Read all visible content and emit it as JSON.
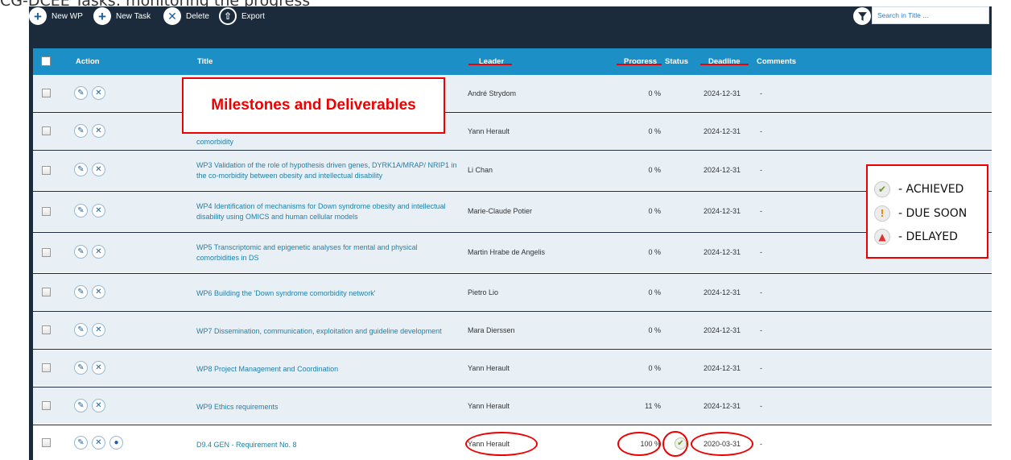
{
  "caption": "CG-DCEE Tasks: monitoring the progress",
  "toolbar": {
    "new_wp": "New WP",
    "new_task": "New Task",
    "delete": "Delete",
    "export": "Export",
    "search_placeholder": "Search in Title ..."
  },
  "columns": {
    "action": "Action",
    "title": "Title",
    "leader": "Leader",
    "progress": "Progress",
    "status": "Status",
    "deadline": "Deadline",
    "comments": "Comments"
  },
  "rows": [
    {
      "title": "",
      "leader": "André Strydom",
      "progress": "0 %",
      "deadline": "2024-12-31",
      "comment": "-"
    },
    {
      "title": "comorbidity",
      "leader": "Yann Herault",
      "progress": "0 %",
      "deadline": "2024-12-31",
      "comment": "-"
    },
    {
      "title": "WP3 Validation of the role of hypothesis driven genes, DYRK1A/MRAP/ NRIP1 in the co-morbidity between obesity and intellectual disability",
      "leader": "Li Chan",
      "progress": "0 %",
      "deadline": "2024-12-31",
      "comment": "-"
    },
    {
      "title": "WP4 Identification of mechanisms for Down syndrome obesity and intellectual disability using OMICS and human cellular models",
      "leader": "Marie-Claude Potier",
      "progress": "0 %",
      "deadline": "2024-12-31",
      "comment": "-"
    },
    {
      "title": "WP5 Transcriptomic and epigenetic analyses for mental and physical comorbidities in DS",
      "leader": "Martin Hrabe de Angelis",
      "progress": "0 %",
      "deadline": "2024-12-31",
      "comment": "-"
    },
    {
      "title": "WP6 Building the 'Down syndrome comorbidity network'",
      "leader": "Pietro Lio",
      "progress": "0 %",
      "deadline": "2024-12-31",
      "comment": "-"
    },
    {
      "title": "WP7 Dissemination, communication, exploitation and guideline development",
      "leader": "Mara Dierssen",
      "progress": "0 %",
      "deadline": "2024-12-31",
      "comment": "-"
    },
    {
      "title": "WP8 Project Management and Coordination",
      "leader": "Yann Herault",
      "progress": "0 %",
      "deadline": "2024-12-31",
      "comment": "-"
    },
    {
      "title": "WP9 Ethics requirements",
      "leader": "Yann Herault",
      "progress": "11 %",
      "deadline": "2024-12-31",
      "comment": "-"
    },
    {
      "title": "D9.4 GEN - Requirement No. 8",
      "leader": "Yann Herault",
      "progress": "100 %",
      "deadline": "2020-03-31",
      "comment": "-",
      "status": "achieved"
    }
  ],
  "annotation": {
    "milestones": "Milestones and Deliverables",
    "legend": [
      "- ACHIEVED",
      "- DUE SOON",
      "- DELAYED"
    ]
  },
  "colors": {
    "header_bg": "#1d8fc7",
    "app_bg": "#1b2b3c",
    "annotation_red": "#e00000",
    "achieved_green": "#6a9e1f",
    "due_soon_orange": "#f08c00",
    "delayed_red": "#e03030"
  },
  "icons": [
    "plus-icon",
    "close-icon",
    "upload-icon",
    "filter-icon",
    "edit-icon",
    "checkmark-icon",
    "exclamation-icon",
    "bell-icon"
  ]
}
